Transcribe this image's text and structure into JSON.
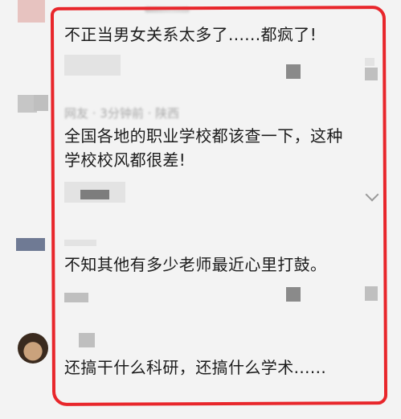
{
  "comments": [
    {
      "text": "不正当男女关系太多了......都疯了!"
    },
    {
      "meta": "网友 · 3分钟前 · 陕西",
      "text_lines": [
        "全国各地的职业学校都该查一下，这种",
        "学校校风都很差!"
      ]
    },
    {
      "text": "不知其他有多少老师最近心里打鼓。"
    },
    {
      "text": "还搞干什么科研，还搞什么学术......"
    }
  ],
  "colors": {
    "highlight": "#e8262b",
    "text": "#1c1c1c",
    "background": "#f3f3f3"
  }
}
